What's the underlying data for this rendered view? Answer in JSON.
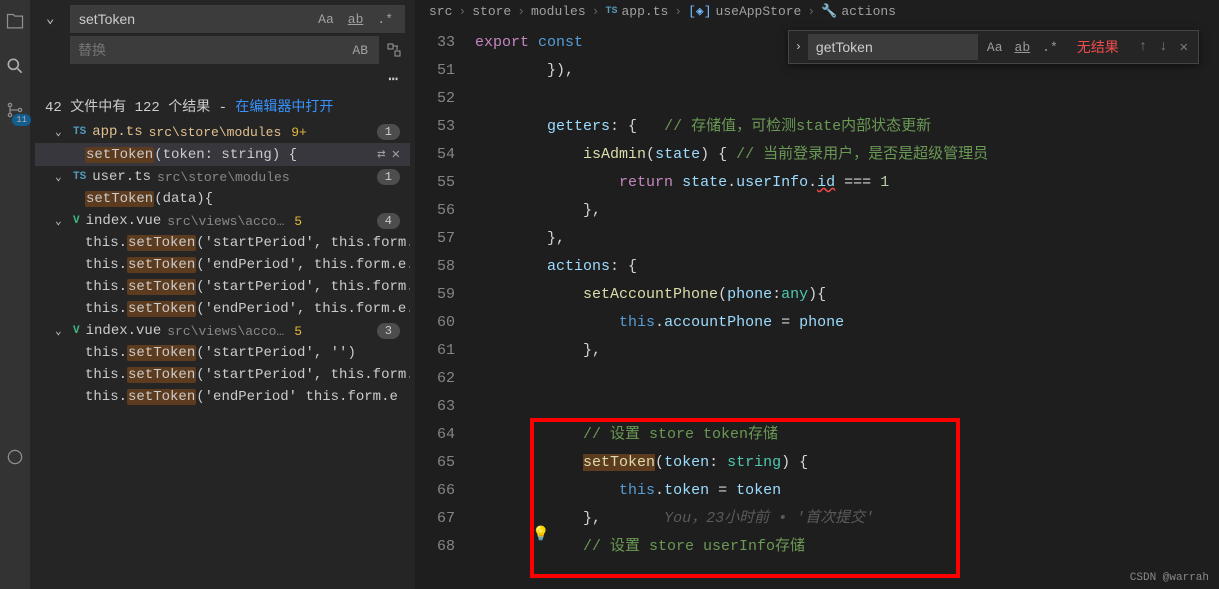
{
  "activity": {
    "badge": "11"
  },
  "search": {
    "query": "setToken",
    "replace_placeholder": "替换",
    "case_label": "Aa",
    "word_label": "ab",
    "regex_label": ".*",
    "preserve_label": "AB",
    "summary_prefix": "42 文件中有 122 个结果 - ",
    "summary_link": "在编辑器中打开"
  },
  "tree": [
    {
      "type": "file",
      "icon": "ts",
      "name": "app.ts",
      "path": "src\\store\\modules",
      "mod": "9+",
      "count": "1",
      "open": true,
      "active": true,
      "matches": [
        {
          "pre": "",
          "hl": "setToken",
          "post": "(token: string) {",
          "selected": true,
          "actions": true
        }
      ]
    },
    {
      "type": "file",
      "icon": "ts",
      "name": "user.ts",
      "path": "src\\store\\modules",
      "count": "1",
      "open": true,
      "matches": [
        {
          "pre": "",
          "hl": "setToken",
          "post": "(data){"
        }
      ]
    },
    {
      "type": "file",
      "icon": "vue",
      "name": "index.vue",
      "path": "src\\views\\acco…",
      "mod": "5",
      "count": "4",
      "open": true,
      "matches": [
        {
          "pre": "this.",
          "hl": "setToken",
          "post": "('startPeriod', this.form...."
        },
        {
          "pre": "this.",
          "hl": "setToken",
          "post": "('endPeriod', this.form.e..."
        },
        {
          "pre": "this.",
          "hl": "setToken",
          "post": "('startPeriod', this.form...."
        },
        {
          "pre": "this.",
          "hl": "setToken",
          "post": "('endPeriod', this.form.e..."
        }
      ]
    },
    {
      "type": "file",
      "icon": "vue",
      "name": "index.vue",
      "path": "src\\views\\acco…",
      "mod": "5",
      "count": "3",
      "open": true,
      "matches": [
        {
          "pre": "this.",
          "hl": "setToken",
          "post": "('startPeriod', '')"
        },
        {
          "pre": "this.",
          "hl": "setToken",
          "post": "('startPeriod', this.form...."
        },
        {
          "pre": "this.",
          "hl": "setToken",
          "post": "('endPeriod'  this.form.e "
        }
      ]
    }
  ],
  "breadcrumbs": [
    "src",
    "store",
    "modules",
    "app.ts",
    "useAppStore",
    "actions"
  ],
  "find": {
    "query": "getToken",
    "case_label": "Aa",
    "word_label": "ab",
    "regex_label": ".*",
    "result": "无结果",
    "up": "↑",
    "down": "↓",
    "close": "✕"
  },
  "code": {
    "export_kw": "export",
    "const_kw": "const",
    "lines": [
      {
        "n": "33",
        "html": "<span class='kw'>export</span> <span class='kw2'>const</span>"
      },
      {
        "n": "51",
        "html": "        <span class='op'>}),</span>"
      },
      {
        "n": "52",
        "html": ""
      },
      {
        "n": "53",
        "html": "        <span class='var'>getters</span><span class='op'>: {</span>   <span class='com'>// 存储值，可检测state内部状态更新</span>"
      },
      {
        "n": "54",
        "html": "            <span class='fn'>isAdmin</span><span class='op'>(</span><span class='var'>state</span><span class='op'>) {</span> <span class='com'>// 当前登录用户，是否是超级管理员</span>"
      },
      {
        "n": "55",
        "html": "                <span class='kw'>return</span> <span class='var'>state</span><span class='op'>.</span><span class='var'>userInfo</span><span class='op'>.</span><span class='var err'>id</span> <span class='op'>===</span> <span class='num'>1</span>"
      },
      {
        "n": "56",
        "html": "            <span class='op'>},</span>"
      },
      {
        "n": "57",
        "html": "        <span class='op'>},</span>"
      },
      {
        "n": "58",
        "html": "        <span class='var'>actions</span><span class='op'>: {</span>"
      },
      {
        "n": "59",
        "html": "            <span class='fn'>setAccountPhone</span><span class='op'>(</span><span class='var'>phone</span><span class='op'>:</span><span class='cls'>any</span><span class='op'>){</span>"
      },
      {
        "n": "60",
        "html": "                <span class='kw2'>this</span><span class='op'>.</span><span class='var'>accountPhone</span> <span class='op'>=</span> <span class='var'>phone</span>"
      },
      {
        "n": "61",
        "html": "            <span class='op'>},</span>"
      },
      {
        "n": "62",
        "html": ""
      },
      {
        "n": "63",
        "html": ""
      },
      {
        "n": "64",
        "html": "            <span class='com'>// 设置 store token存储</span>"
      },
      {
        "n": "65",
        "html": "            <span class='fn hl-match'>setToken</span><span class='op'>(</span><span class='var'>token</span><span class='op'>:</span> <span class='cls'>string</span><span class='op'>) {</span>"
      },
      {
        "n": "66",
        "html": "                <span class='kw2'>this</span><span class='op'>.</span><span class='var'>token</span> <span class='op'>=</span> <span class='var'>token</span>"
      },
      {
        "n": "67",
        "html": "            <span class='op'>},</span>       <span class='git-lens'>You，23小时前 • '首次提交'</span>"
      },
      {
        "n": "68",
        "html": "            <span class='com'>// 设置 store userInfo存储</span>"
      }
    ]
  },
  "watermark": "CSDN @warrah"
}
